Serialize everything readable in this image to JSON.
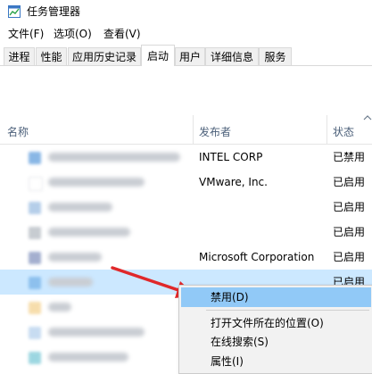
{
  "window": {
    "title": "任务管理器",
    "icon": "task-manager-icon"
  },
  "menu": [
    "文件(F)",
    "选项(O)",
    "查看(V)"
  ],
  "tabs": [
    "进程",
    "性能",
    "应用历史记录",
    "启动",
    "用户",
    "详细信息",
    "服务"
  ],
  "active_tab": "启动",
  "columns": {
    "name": "名称",
    "publisher": "发布者",
    "status": "状态"
  },
  "rows": [
    {
      "publisher": "INTEL CORP",
      "status": "已禁用",
      "icon_color": "#2a7dd1"
    },
    {
      "publisher": "VMware, Inc.",
      "status": "已启用",
      "icon_color": "#ffffff"
    },
    {
      "publisher": "",
      "status": "已启用",
      "icon_color": "#7aa7d8"
    },
    {
      "publisher": "",
      "status": "已启用",
      "icon_color": "#9aa3ad"
    },
    {
      "publisher": "Microsoft Corporation",
      "status": "已启用",
      "icon_color": "#5a6fa8"
    },
    {
      "publisher": "",
      "status": "已启用",
      "icon_color": "#5aa0e0",
      "selected": true
    },
    {
      "publisher": "",
      "status": "",
      "icon_color": "#f0c36a"
    },
    {
      "publisher": "",
      "status": "",
      "icon_color": "#9ac0e6"
    },
    {
      "publisher": "",
      "status": "",
      "icon_color": "#4db6c9"
    }
  ],
  "context_menu": {
    "items": [
      "禁用(D)",
      "打开文件所在的位置(O)",
      "在线搜索(S)",
      "属性(I)"
    ],
    "highlighted": "禁用(D)"
  },
  "colors": {
    "selection": "#cce8ff",
    "menu_highlight": "#91c9f7",
    "annotation_arrow": "#e0282a",
    "header_text": "#4c607a"
  }
}
